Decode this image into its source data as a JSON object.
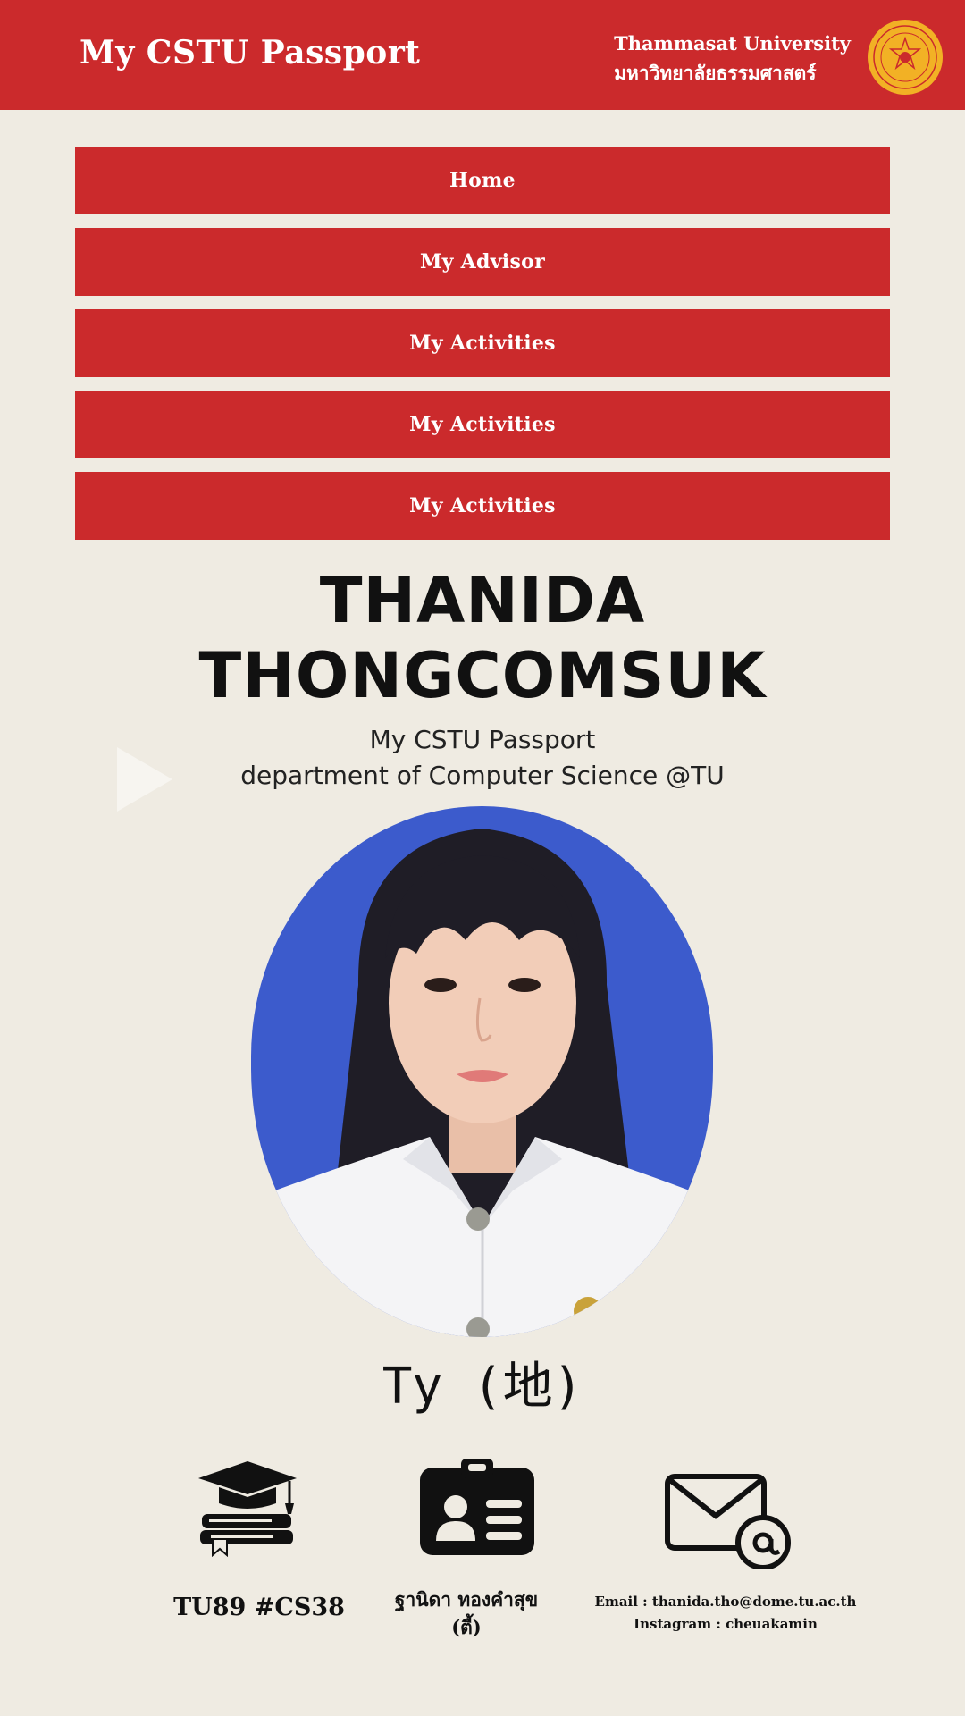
{
  "header": {
    "app_title": "My CSTU Passport",
    "university_en": "Thammasat University",
    "university_th": "มหาวิทยาลัยธรรมศาสตร์",
    "brand_color": "#cb2a2c",
    "seal_color": "#f2b125"
  },
  "nav": {
    "items": [
      {
        "label": "Home"
      },
      {
        "label": "My Advisor"
      },
      {
        "label": "My Activities"
      },
      {
        "label": "My Activities"
      },
      {
        "label": "My Activities"
      }
    ]
  },
  "profile": {
    "first_name": "THANIDA",
    "last_name": "THONGCOMSUK",
    "subtitle_line1": "My CSTU Passport",
    "subtitle_line2": "department of Computer Science @TU",
    "nickname": "Ty (地)",
    "photo_bg": "#3c5bcc"
  },
  "info": {
    "student_id": "TU89 #CS38",
    "thai_name_line1": "ฐานิดา ทองคำสุข",
    "thai_name_line2": "(ตี้)",
    "email_line": "Email : thanida.tho@dome.tu.ac.th",
    "instagram_line": "Instagram : cheuakamin",
    "icons": [
      "graduation-books-icon",
      "id-card-icon",
      "email-at-icon"
    ]
  }
}
